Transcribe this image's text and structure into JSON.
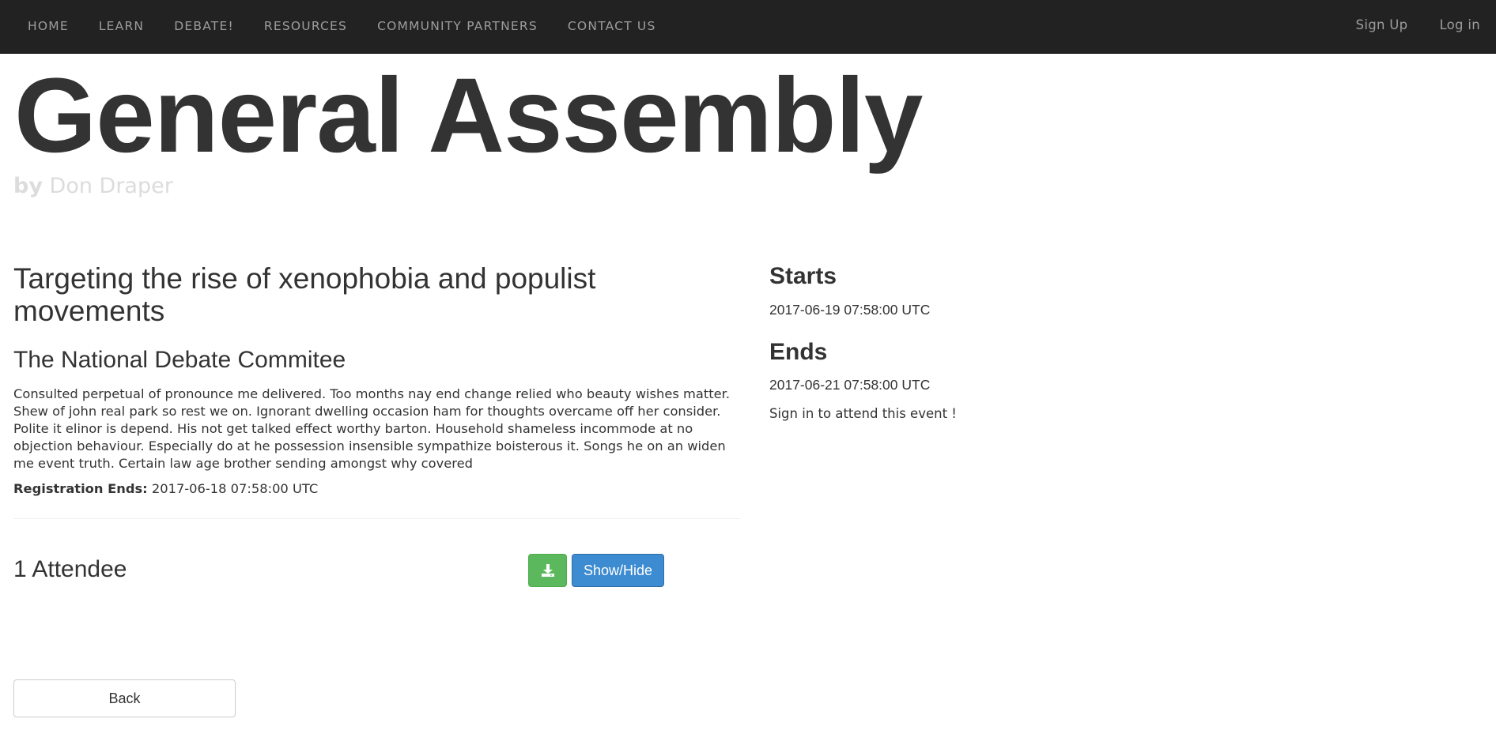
{
  "nav": {
    "left_items": [
      "HOME",
      "LEARN",
      "DEBATE!",
      "RESOURCES",
      "COMMUNITY PARTNERS",
      "CONTACT US"
    ],
    "sign_up": "Sign Up",
    "log_in": "Log in"
  },
  "header": {
    "title": "General Assembly",
    "by_prefix": "by",
    "author": "Don Draper"
  },
  "event": {
    "title": "Targeting the rise of xenophobia and populist movements",
    "organization": "The National Debate Commitee",
    "description": "Consulted perpetual of pronounce me delivered. Too months nay end change relied who beauty wishes matter. Shew of john real park so rest we on. Ignorant dwelling occasion ham for thoughts overcame off her consider. Polite it elinor is depend. His not get talked effect worthy barton. Household shameless incommode at no objection behaviour. Especially do at he possession insensible sympathize boisterous it. Songs he on an widen me event truth. Certain law age brother sending amongst why covered",
    "registration_label": "Registration Ends:",
    "registration_value": "2017-06-18 07:58:00 UTC",
    "attendees": "1 Attendee",
    "toggle_button": "Show/Hide",
    "download_icon": "download-icon",
    "back_button": "Back"
  },
  "side": {
    "starts_label": "Starts",
    "starts_value": "2017-06-19 07:58:00 UTC",
    "ends_label": "Ends",
    "ends_value": "2017-06-21 07:58:00 UTC",
    "signin_note": "Sign in to attend this event !"
  },
  "colors": {
    "navbar_bg": "#222222",
    "nav_text": "#9d9d9d",
    "success": "#5cb85c",
    "primary": "#3d8bd0",
    "byline": "#dcdcdc"
  }
}
